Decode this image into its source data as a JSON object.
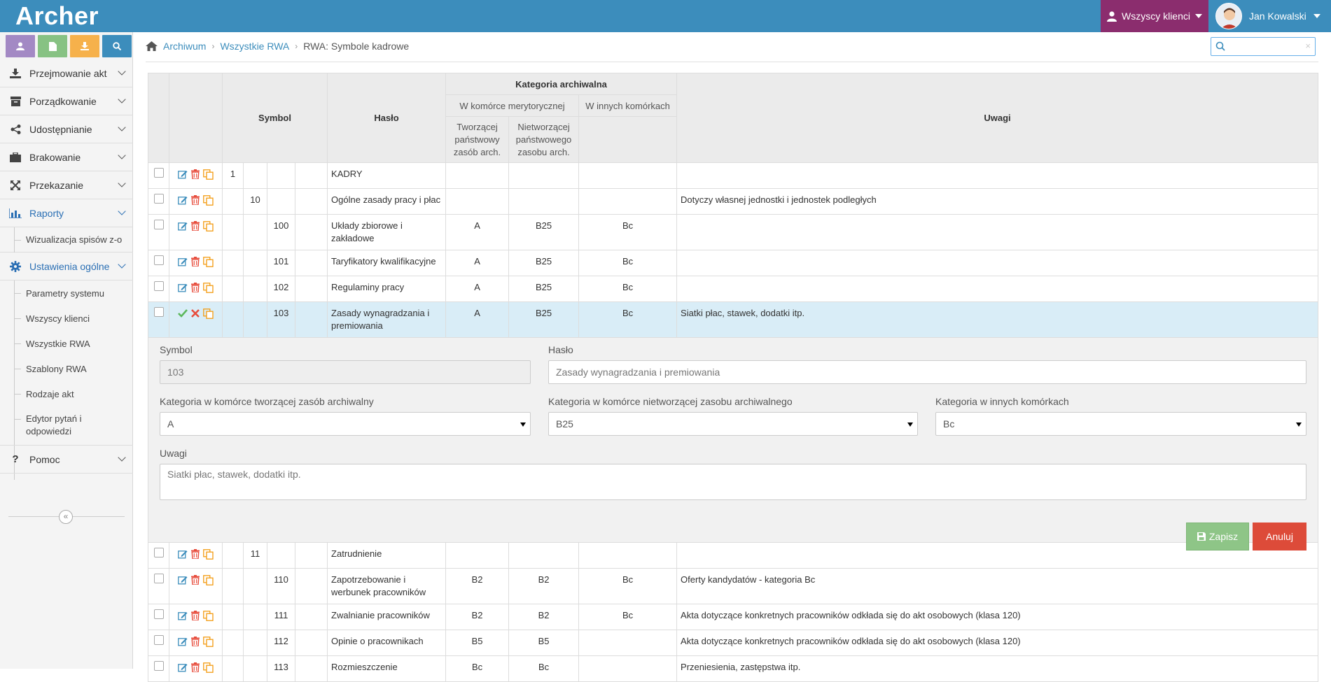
{
  "app": {
    "logo": "Archer"
  },
  "header": {
    "clients_label": "Wszyscy klienci",
    "user_name": "Jan Kowalski"
  },
  "sidebar": {
    "quick_buttons": [
      {
        "icon": "user-icon",
        "color": "#a389c4"
      },
      {
        "icon": "document-icon",
        "color": "#87c283"
      },
      {
        "icon": "download-icon",
        "color": "#f6b14b"
      },
      {
        "icon": "search-icon",
        "color": "#3c8dbc"
      }
    ],
    "menu": {
      "przejmowanie": "Przejmowanie akt",
      "porzadkowanie": "Porządkowanie",
      "udostepnianie": "Udostępnianie",
      "brakowanie": "Brakowanie",
      "przekazanie": "Przekazanie",
      "raporty": "Raporty",
      "wizualizacja": "Wizualizacja spisów z-o",
      "ustawienia": "Ustawienia ogólne",
      "parametry": "Parametry systemu",
      "wszyscy_klienci": "Wszyscy klienci",
      "wszystkie_rwa": "Wszystkie RWA",
      "szablony_rwa": "Szablony RWA",
      "rodzaje_akt": "Rodzaje akt",
      "edytor_1": "Edytor pytań i",
      "edytor_2": "odpowiedzi",
      "pomoc": "Pomoc"
    }
  },
  "breadcrumb": {
    "home": "Archiwum",
    "level2": "Wszystkie RWA",
    "current": "RWA: Symbole kadrowe"
  },
  "search": {
    "placeholder": ""
  },
  "table": {
    "headers": {
      "symbol": "Symbol",
      "haslo": "Hasło",
      "kategoria": "Kategoria archiwalna",
      "w_komorce": "W komórce merytorycznej",
      "w_innych": "W innych komórkach",
      "tworzacej_1": "Tworzącej",
      "tworzacej_2": "państwowy",
      "tworzacej_3": "zasób arch.",
      "nietworzacej_1": "Nietworzącej",
      "nietworzacej_2": "państwowego",
      "nietworzacej_3": "zasobu arch.",
      "uwagi": "Uwagi"
    },
    "rows_top": [
      {
        "s1": "1",
        "s2": "",
        "s3": "",
        "haslo": "KADRY",
        "t": "",
        "n": "",
        "i": "",
        "uwagi": "",
        "mode": "normal"
      },
      {
        "s1": "",
        "s2": "10",
        "s3": "",
        "haslo": "Ogólne zasady pracy i płac",
        "t": "",
        "n": "",
        "i": "",
        "uwagi": "Dotyczy własnej jednostki i jednostek podległych",
        "mode": "normal"
      },
      {
        "s1": "",
        "s2": "",
        "s3": "100",
        "haslo": "Układy zbiorowe i zakładowe",
        "t": "A",
        "n": "B25",
        "i": "Bc",
        "uwagi": "",
        "mode": "normal"
      },
      {
        "s1": "",
        "s2": "",
        "s3": "101",
        "haslo": "Taryfikatory kwalifikacyjne",
        "t": "A",
        "n": "B25",
        "i": "Bc",
        "uwagi": "",
        "mode": "normal"
      },
      {
        "s1": "",
        "s2": "",
        "s3": "102",
        "haslo": "Regulaminy pracy",
        "t": "A",
        "n": "B25",
        "i": "Bc",
        "uwagi": "",
        "mode": "normal"
      },
      {
        "s1": "",
        "s2": "",
        "s3": "103",
        "haslo": "Zasady wynagradzania i premiowania",
        "t": "A",
        "n": "B25",
        "i": "Bc",
        "uwagi": "Siatki płac, stawek, dodatki itp.",
        "mode": "edit"
      }
    ],
    "rows_bottom": [
      {
        "s1": "",
        "s2": "11",
        "s3": "",
        "haslo": "Zatrudnienie",
        "t": "",
        "n": "",
        "i": "",
        "uwagi": ""
      },
      {
        "s1": "",
        "s2": "",
        "s3": "110",
        "haslo": "Zapotrzebowanie i werbunek pracowników",
        "t": "B2",
        "n": "B2",
        "i": "Bc",
        "uwagi": "Oferty kandydatów - kategoria Bc"
      },
      {
        "s1": "",
        "s2": "",
        "s3": "111",
        "haslo": "Zwalnianie pracowników",
        "t": "B2",
        "n": "B2",
        "i": "Bc",
        "uwagi": "Akta dotyczące konkretnych pracowników odkłada się do akt osobowych (klasa 120)"
      },
      {
        "s1": "",
        "s2": "",
        "s3": "112",
        "haslo": "Opinie o pracownikach",
        "t": "B5",
        "n": "B5",
        "i": "",
        "uwagi": "Akta dotyczące konkretnych pracowników odkłada się do akt osobowych (klasa 120)"
      },
      {
        "s1": "",
        "s2": "",
        "s3": "113",
        "haslo": "Rozmieszczenie",
        "t": "Bc",
        "n": "Bc",
        "i": "",
        "uwagi": "Przeniesienia, zastępstwa itp."
      }
    ]
  },
  "form": {
    "symbol_label": "Symbol",
    "symbol_value": "103",
    "haslo_label": "Hasło",
    "haslo_value": "Zasady wynagradzania i premiowania",
    "kat_tworzacej_label": "Kategoria w komórce tworzącej zasób archiwalny",
    "kat_tworzacej_value": "A",
    "kat_nietworzacej_label": "Kategoria w komórce nietworzącej zasobu archiwalnego",
    "kat_nietworzacej_value": "B25",
    "kat_innych_label": "Kategoria w innych komórkach",
    "kat_innych_value": "Bc",
    "uwagi_label": "Uwagi",
    "uwagi_value": "Siatki płac, stawek, dodatki itp.",
    "save_label": "Zapisz",
    "cancel_label": "Anuluj"
  },
  "colors": {
    "topbar": "#3c8dbc",
    "clients": "#8b2d6e",
    "active_menu": "#2a6fb4",
    "save": "#8ec587",
    "cancel": "#dd4b39",
    "selected_row": "#d9edf7"
  }
}
